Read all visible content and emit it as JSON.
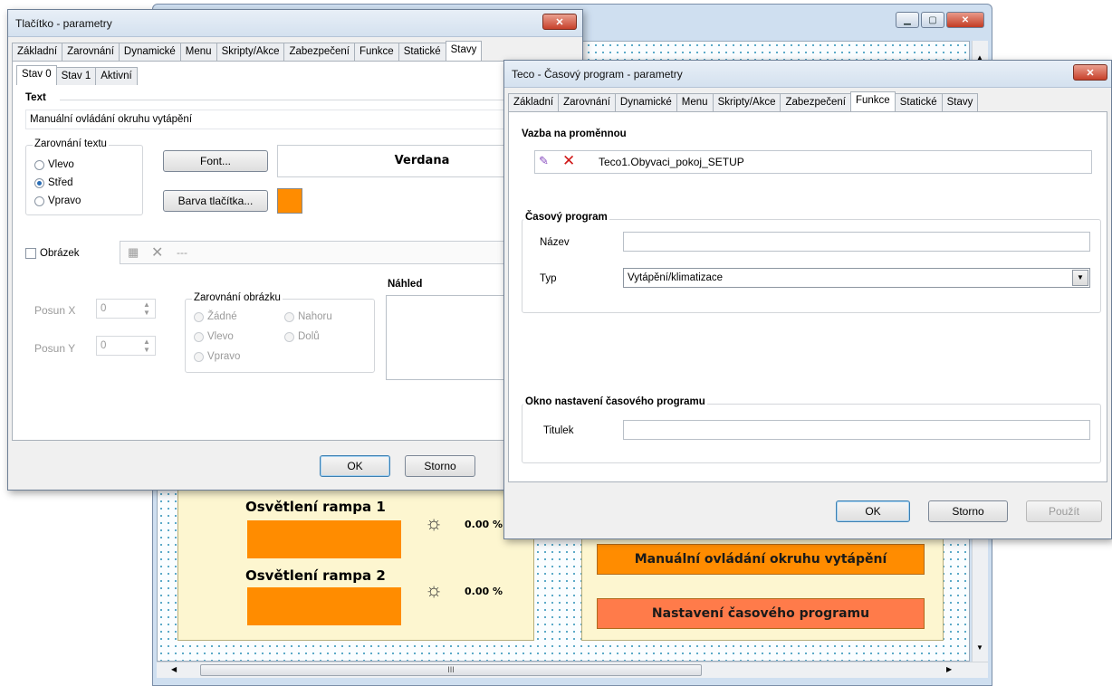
{
  "designer": {
    "panel_left": {
      "rows": [
        {
          "label": "Osvětlení rampa 1",
          "value": "0.00 %"
        },
        {
          "label": "Osvětlení rampa 2",
          "value": "0.00 %"
        }
      ]
    },
    "buttons": {
      "manual": "Manuální ovládání okruhu vytápění",
      "schedule": "Nastavení časového programu"
    },
    "colors": {
      "orange": "#ff8c00",
      "panel": "#fdf6d0",
      "schedule_button": "#ff7b4a"
    },
    "scroll_thumb_grip": "III"
  },
  "dialog_button": {
    "title": "Tlačítko - parametry",
    "tabs": [
      "Základní",
      "Zarovnání",
      "Dynamické",
      "Menu",
      "Skripty/Akce",
      "Zabezpečení",
      "Funkce",
      "Statické",
      "Stavy"
    ],
    "active_tab": "Stavy",
    "subtabs": [
      "Stav 0",
      "Stav 1",
      "Aktivní"
    ],
    "text_section": "Text",
    "text_value": "Manuální ovládání okruhu vytápění",
    "align_group": "Zarovnání textu",
    "align_options": [
      "Vlevo",
      "Střed",
      "Vpravo"
    ],
    "align_selected": "Střed",
    "font_button": "Font...",
    "font_preview": "Verdana",
    "color_button": "Barva tlačítka...",
    "button_color": "#ff8c00",
    "image_checkbox": "Obrázek",
    "image_path": "---",
    "posun_x_label": "Posun X",
    "posun_x": "0",
    "posun_y_label": "Posun Y",
    "posun_y": "0",
    "img_align_group": "Zarovnání obrázku",
    "img_align_options": [
      "Žádné",
      "Nahoru",
      "Vlevo",
      "Dolů",
      "Vpravo"
    ],
    "preview_label": "Náhled",
    "ok": "OK",
    "cancel": "Storno"
  },
  "dialog_teco": {
    "title": "Teco - Časový program - parametry",
    "tabs": [
      "Základní",
      "Zarovnání",
      "Dynamické",
      "Menu",
      "Skripty/Akce",
      "Zabezpečení",
      "Funkce",
      "Statické",
      "Stavy"
    ],
    "active_tab": "Funkce",
    "binding_section": "Vazba na proměnnou",
    "binding_value": "Teco1.Obyvaci_pokoj_SETUP",
    "schedule_section": "Časový program",
    "name_label": "Název",
    "name_value": "",
    "type_label": "Typ",
    "type_value": "Vytápění/klimatizace",
    "window_section": "Okno nastavení časového programu",
    "caption_label": "Titulek",
    "caption_value": "",
    "ok": "OK",
    "cancel": "Storno",
    "apply": "Použít"
  }
}
